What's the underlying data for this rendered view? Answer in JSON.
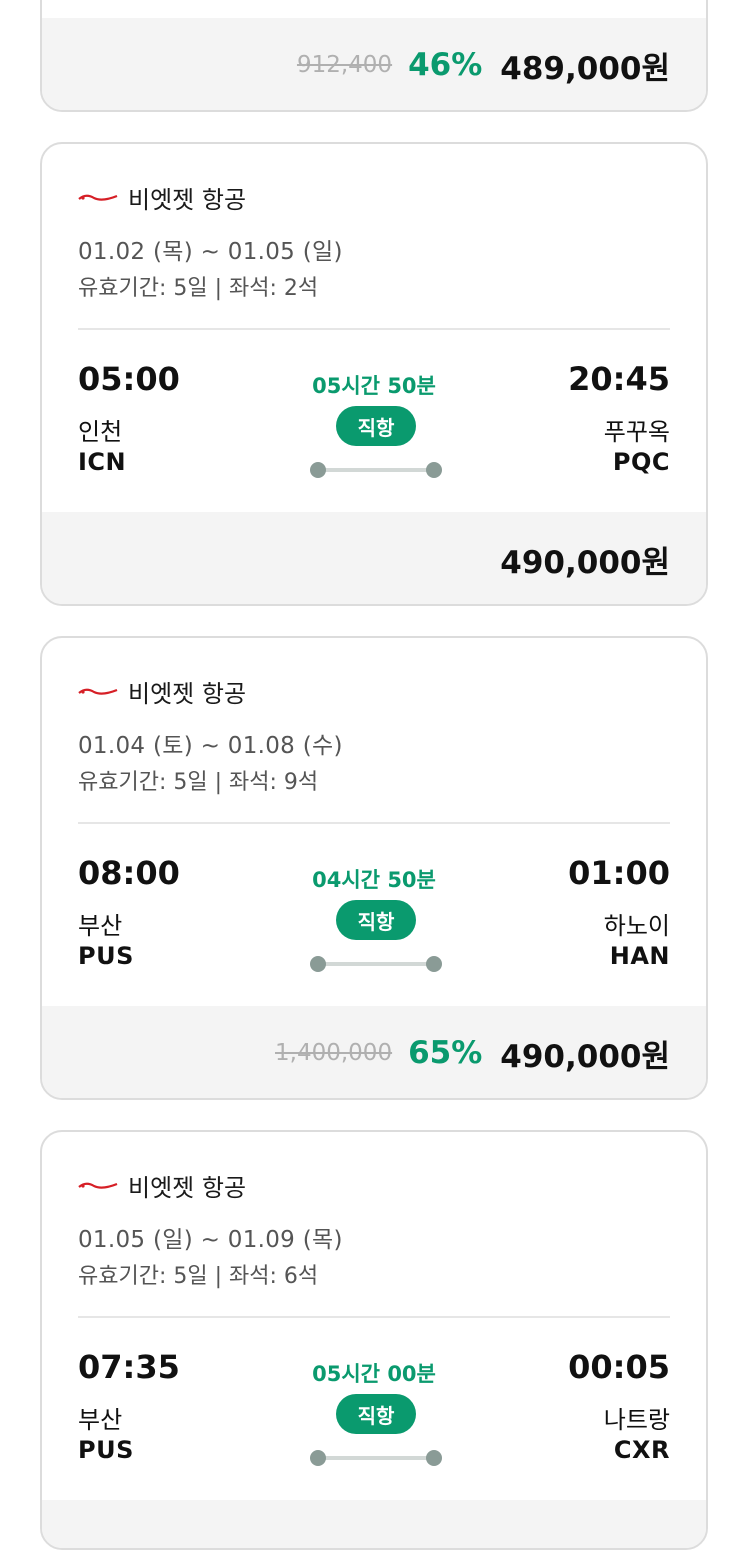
{
  "colors": {
    "accent": "#0a9a6e",
    "price_bar_bg": "#f4f4f4",
    "logo_red": "#d61f26"
  },
  "top_card": {
    "original_price": "912,400",
    "discount": "46%",
    "price": "489,000원"
  },
  "flights": [
    {
      "airline_logo_icon": "vietjet-logo-icon",
      "airline": "비엣젯 항공",
      "dates": "01.02 (목) ~ 01.05 (일)",
      "validity": "유효기간: 5일 | 좌석: 2석",
      "dep_time": "05:00",
      "dep_city": "인천",
      "dep_code": "ICN",
      "duration": "05시간 50분",
      "badge": "직항",
      "arr_time": "20:45",
      "arr_city": "푸꾸옥",
      "arr_code": "PQC",
      "original_price": "",
      "discount": "",
      "price": "490,000원"
    },
    {
      "airline_logo_icon": "vietjet-logo-icon",
      "airline": "비엣젯 항공",
      "dates": "01.04 (토) ~ 01.08 (수)",
      "validity": "유효기간: 5일 | 좌석: 9석",
      "dep_time": "08:00",
      "dep_city": "부산",
      "dep_code": "PUS",
      "duration": "04시간 50분",
      "badge": "직항",
      "arr_time": "01:00",
      "arr_city": "하노이",
      "arr_code": "HAN",
      "original_price": "1,400,000",
      "discount": "65%",
      "price": "490,000원"
    },
    {
      "airline_logo_icon": "vietjet-logo-icon",
      "airline": "비엣젯 항공",
      "dates": "01.05 (일) ~ 01.09 (목)",
      "validity": "유효기간: 5일 | 좌석: 6석",
      "dep_time": "07:35",
      "dep_city": "부산",
      "dep_code": "PUS",
      "duration": "05시간 00분",
      "badge": "직항",
      "arr_time": "00:05",
      "arr_city": "나트랑",
      "arr_code": "CXR"
    }
  ]
}
